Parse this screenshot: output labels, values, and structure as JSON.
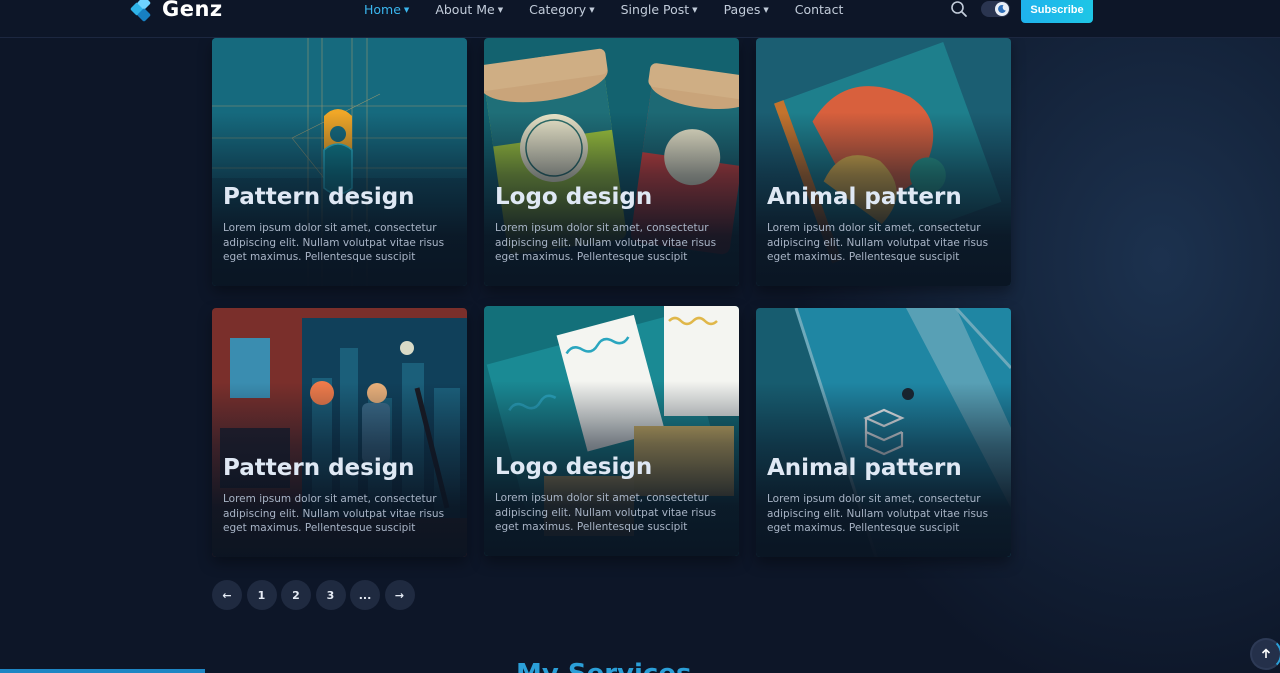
{
  "brand": {
    "name": "Genz",
    "accent": "#2fb3e8"
  },
  "nav": {
    "items": [
      {
        "label": "Home",
        "dropdown": true,
        "active": true
      },
      {
        "label": "About Me",
        "dropdown": true,
        "active": false
      },
      {
        "label": "Category",
        "dropdown": true,
        "active": false
      },
      {
        "label": "Single Post",
        "dropdown": true,
        "active": false
      },
      {
        "label": "Pages",
        "dropdown": true,
        "active": false
      },
      {
        "label": "Contact",
        "dropdown": false,
        "active": false
      }
    ],
    "search_icon": "search-icon",
    "theme_toggle_icon": "moon-icon",
    "subscribe_label": "Subscribe"
  },
  "cards": [
    {
      "title": "Pattern design",
      "description": "Lorem ipsum dolor sit amet, consectetur adipiscing elit. Nullam volutpat vitae risus eget maximus. Pellentesque suscipit"
    },
    {
      "title": "Logo design",
      "description": "Lorem ipsum dolor sit amet, consectetur adipiscing elit. Nullam volutpat vitae risus eget maximus. Pellentesque suscipit"
    },
    {
      "title": "Animal pattern",
      "description": "Lorem ipsum dolor sit amet, consectetur adipiscing elit. Nullam volutpat vitae risus eget maximus. Pellentesque suscipit"
    },
    {
      "title": "Pattern design",
      "description": "Lorem ipsum dolor sit amet, consectetur adipiscing elit. Nullam volutpat vitae risus eget maximus. Pellentesque suscipit"
    },
    {
      "title": "Logo design",
      "description": "Lorem ipsum dolor sit amet, consectetur adipiscing elit. Nullam volutpat vitae risus eget maximus. Pellentesque suscipit"
    },
    {
      "title": "Animal pattern",
      "description": "Lorem ipsum dolor sit amet, consectetur adipiscing elit. Nullam volutpat vitae risus eget maximus. Pellentesque suscipit"
    }
  ],
  "pagination": {
    "prev_label": "←",
    "pages": [
      "1",
      "2",
      "3",
      "..."
    ],
    "next_label": "→"
  },
  "next_section_title": "My Services",
  "back_to_top_icon": "arrow-up-icon"
}
